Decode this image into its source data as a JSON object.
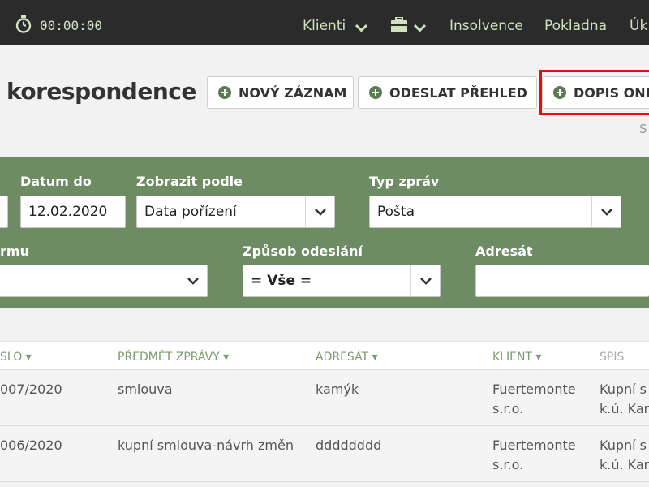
{
  "topbar": {
    "timer": "00:00:00",
    "nav": {
      "clients": "Klienti",
      "insolvency": "Insolvence",
      "cashbox": "Pokladna",
      "cut": "Úk"
    }
  },
  "page": {
    "title": "korespondence",
    "buttons": {
      "new_record": "NOVÝ ZÁZNAM",
      "send_overview": "ODESLAT PŘEHLED",
      "letter_online": "DOPIS ONLI"
    },
    "cut_text": "S"
  },
  "filters": {
    "date_to_label": "Datum do",
    "date_to_value": "12.02.2020",
    "show_by_label": "Zobrazit podle",
    "show_by_value": "Data pořízení",
    "message_type_label": "Typ zpráv",
    "message_type_value": "Pošta",
    "form_label": "rmu",
    "send_method_label": "Způsob odeslání",
    "send_method_value": "= Vše =",
    "recipient_label": "Adresát"
  },
  "table": {
    "headers": {
      "number": "SLO",
      "subject": "PŘEDMĚT ZPRÁVY",
      "recipient": "ADRESÁT",
      "client": "KLIENT",
      "file": "SPIS"
    },
    "rows": [
      {
        "number": "007/2020",
        "subject": "smlouva",
        "recipient": "kamýk",
        "client_line1": "Fuertemonte",
        "client_line2": "s.r.o.",
        "file_line1": "Kupní s",
        "file_line2": "k.ú. Kar"
      },
      {
        "number": "006/2020",
        "subject": "kupní smlouva-návrh změn",
        "recipient": "dddddddd",
        "client_line1": "Fuertemonte",
        "client_line2": "s.r.o.",
        "file_line1": "Kupní s",
        "file_line2": "k.ú. Kar"
      }
    ]
  },
  "colors": {
    "topbar": "#2b2b2b",
    "accent_green": "#6e8c63",
    "highlight_red": "#e01010"
  }
}
